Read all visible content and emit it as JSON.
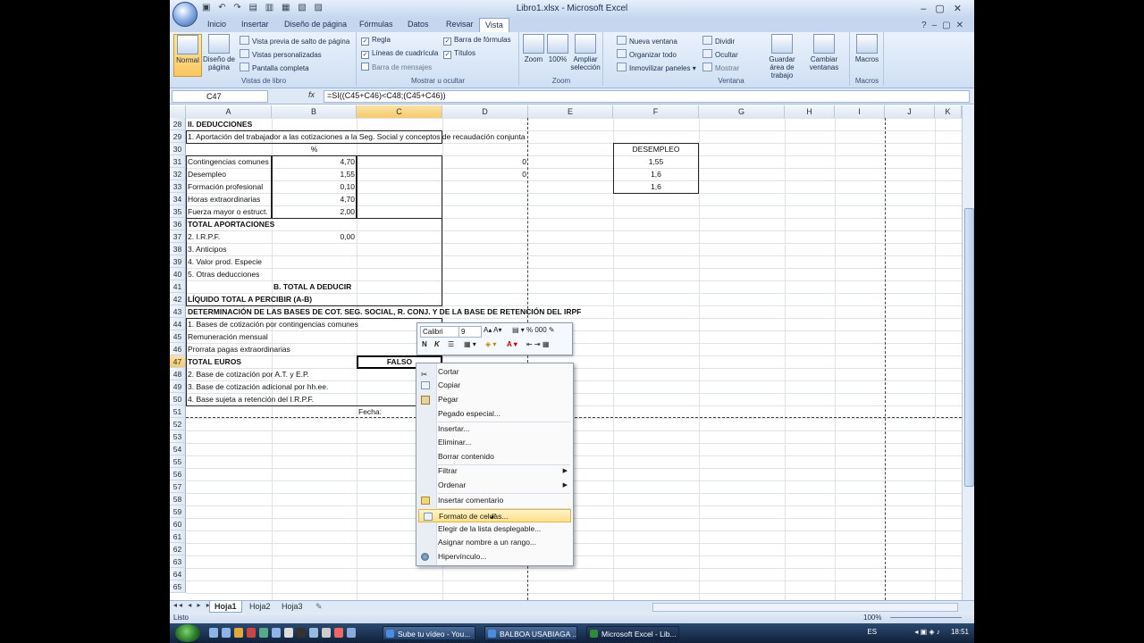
{
  "window": {
    "title": "Libro1.xlsx - Microsoft Excel"
  },
  "ribbon": {
    "tabs": [
      "Inicio",
      "Insertar",
      "Diseño de página",
      "Fórmulas",
      "Datos",
      "Revisar",
      "Vista"
    ],
    "active_tab": "Vista",
    "groups": {
      "vistas": {
        "label": "Vistas de libro",
        "normal": "Normal",
        "diseno_pagina": "Diseño de página",
        "items": [
          "Vista previa de salto de página",
          "Vistas personalizadas",
          "Pantalla completa"
        ]
      },
      "mostrar": {
        "label": "Mostrar u ocultar",
        "regla": "Regla",
        "lineas": "Líneas de cuadrícula",
        "barra_mensajes": "Barra de mensajes",
        "barra_formulas": "Barra de fórmulas",
        "titulos": "Títulos"
      },
      "zoom": {
        "label": "Zoom",
        "zoom": "Zoom",
        "pct": "100%",
        "ampliar": "Ampliar selección"
      },
      "ventana": {
        "label": "Ventana",
        "left_items": [
          "Nueva ventana",
          "Organizar todo",
          "Inmovilizar paneles"
        ],
        "right_items": [
          "Dividir",
          "Ocultar",
          "Mostrar"
        ],
        "guardar": "Guardar área de trabajo",
        "cambiar": "Cambiar ventanas"
      },
      "macros": {
        "label": "Macros",
        "macros": "Macros"
      }
    }
  },
  "formula_bar": {
    "name_box": "C47",
    "fx": "fx",
    "formula": "=SI((C45+C46)<C48;(C45+C46))"
  },
  "columns": [
    "A",
    "B",
    "C",
    "D",
    "E",
    "F",
    "G",
    "H",
    "I",
    "J",
    "K"
  ],
  "rows": [
    {
      "n": "28",
      "A": "II. DEDUCCIONES"
    },
    {
      "n": "29",
      "A": "1. Aportación del trabajador a las cotizaciones a la Seg. Social y conceptos de recaudación conjunta"
    },
    {
      "n": "30",
      "B": "%",
      "F": "DESEMPLEO"
    },
    {
      "n": "31",
      "A": "Contingencias comunes",
      "B": "4,70",
      "D": "0",
      "F": "1,55"
    },
    {
      "n": "32",
      "A": "Desempleo",
      "B": "1,55",
      "D": "0",
      "F": "1,6"
    },
    {
      "n": "33",
      "A": "Formación profesional",
      "B": "0,10",
      "F": "1,6"
    },
    {
      "n": "34",
      "A": "Horas extraordinarias",
      "B": "4,70"
    },
    {
      "n": "35",
      "A": "Fuerza mayor o estruct.",
      "B": "2,00"
    },
    {
      "n": "36",
      "A": "TOTAL APORTACIONES"
    },
    {
      "n": "37",
      "A": "2. I.R.P.F.",
      "B": "0,00"
    },
    {
      "n": "38",
      "A": "3. Anticipos"
    },
    {
      "n": "39",
      "A": "4. Valor prod. Especie"
    },
    {
      "n": "40",
      "A": "5. Otras deducciones"
    },
    {
      "n": "41",
      "B": "B. TOTAL A DEDUCIR"
    },
    {
      "n": "42",
      "A": "LÍQUIDO TOTAL A PERCIBIR (A-B)"
    },
    {
      "n": "43",
      "A": "DETERMINACIÓN DE LAS BASES DE COT. SEG. SOCIAL, R. CONJ. Y DE LA BASE DE RETENCIÓN DEL IRPF"
    },
    {
      "n": "44",
      "A": "1. Bases de cotización por contingencias comunes"
    },
    {
      "n": "45",
      "A": "Remuneración mensual"
    },
    {
      "n": "46",
      "A": "Prorrata pagas extraordinarias"
    },
    {
      "n": "47",
      "A": "TOTAL EUROS",
      "C": "FALSO"
    },
    {
      "n": "48",
      "A": "2. Base de cotización por A.T. y E.P."
    },
    {
      "n": "49",
      "A": "3. Base de cotización adicional por hh.ee."
    },
    {
      "n": "50",
      "A": "4. Base sujeta a retención del I.R.P.F."
    },
    {
      "n": "51",
      "C": "Fecha:"
    },
    {
      "n": "52"
    },
    {
      "n": "53"
    },
    {
      "n": "54"
    },
    {
      "n": "55"
    },
    {
      "n": "56"
    },
    {
      "n": "57"
    },
    {
      "n": "58"
    },
    {
      "n": "59"
    },
    {
      "n": "60"
    },
    {
      "n": "61"
    },
    {
      "n": "62"
    },
    {
      "n": "63"
    },
    {
      "n": "64"
    },
    {
      "n": "65"
    }
  ],
  "mini_toolbar": {
    "font": "Calibri",
    "size": "9",
    "bold": "N",
    "italic": "K"
  },
  "context_menu": {
    "items": [
      {
        "label": "Cortar",
        "icon": "scissors-icon"
      },
      {
        "label": "Copiar",
        "icon": "copy-icon"
      },
      {
        "label": "Pegar",
        "icon": "paste-icon"
      },
      {
        "label": "Pegado especial..."
      },
      {
        "label": "Insertar..."
      },
      {
        "label": "Eliminar..."
      },
      {
        "label": "Borrar contenido"
      },
      {
        "label": "Filtrar",
        "submenu": true
      },
      {
        "label": "Ordenar",
        "submenu": true
      },
      {
        "label": "Insertar comentario",
        "icon": "comment-icon"
      },
      {
        "label": "Formato de celdas...",
        "icon": "format-cells-icon",
        "highlighted": true
      },
      {
        "label": "Elegir de la lista desplegable..."
      },
      {
        "label": "Asignar nombre a un rango..."
      },
      {
        "label": "Hipervínculo...",
        "icon": "hyperlink-icon"
      }
    ]
  },
  "sheets": [
    "Hoja1",
    "Hoja2",
    "Hoja3"
  ],
  "active_sheet": "Hoja1",
  "status": {
    "text": "Listo",
    "zoom": "100%"
  },
  "taskbar": {
    "items": [
      "Sube tu vídeo - You...",
      "BALBOA USABIAGA ...",
      "Microsoft Excel - Lib..."
    ],
    "lang": "ES",
    "clock": "18:51"
  },
  "colors": {
    "selection": "#f7c96a",
    "ribbon": "#cfdff3",
    "highlight": "#fbe08a"
  }
}
